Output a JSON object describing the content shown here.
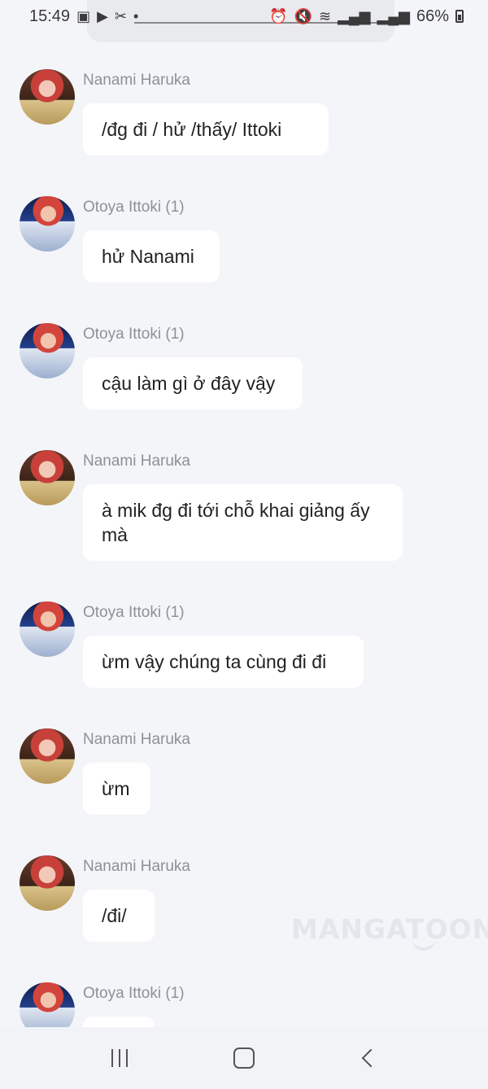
{
  "status_bar": {
    "time": "15:49",
    "battery": "66%",
    "left_icons": [
      "image-icon",
      "youtube-icon",
      "capcut-icon",
      "dot-icon"
    ],
    "right_icons": [
      "alarm-icon",
      "mute-icon",
      "wifi-icon",
      "signal-icon",
      "signal-icon",
      "battery-icon"
    ]
  },
  "messages": [
    {
      "sender": "Nanami Haruka",
      "avatar": "nanami",
      "text": "/đg đi / hử /thấy/ Ittoki"
    },
    {
      "sender": "Otoya Ittoki (1)",
      "avatar": "otoya",
      "text": "hử Nanami"
    },
    {
      "sender": "Otoya Ittoki (1)",
      "avatar": "otoya",
      "text": "cậu làm gì ở đây vậy"
    },
    {
      "sender": "Nanami Haruka",
      "avatar": "nanami",
      "text": "à mik đg đi tới chỗ khai giảng ấy mà"
    },
    {
      "sender": "Otoya Ittoki (1)",
      "avatar": "otoya",
      "text": "ừm vậy chúng ta cùng đi đi"
    },
    {
      "sender": "Nanami Haruka",
      "avatar": "nanami",
      "text": "ừm"
    },
    {
      "sender": "Nanami Haruka",
      "avatar": "nanami",
      "text": "/đi/"
    },
    {
      "sender": "Otoya Ittoki (1)",
      "avatar": "otoya",
      "text": ""
    }
  ],
  "watermark": "MANGATOON",
  "nav_bar": {
    "recent_icon": "recent-apps-icon",
    "home_icon": "home-icon",
    "back_icon": "back-icon"
  }
}
